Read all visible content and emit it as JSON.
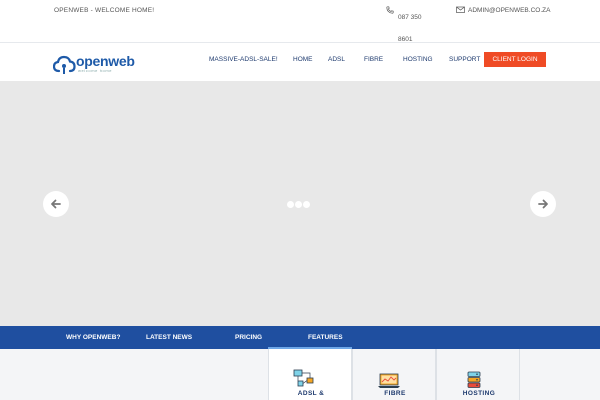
{
  "topbar": {
    "tagline": "OPENWEB - WELCOME HOME!",
    "phone": "087 350 8601",
    "email": "ADMIN@OPENWEB.CO.ZA"
  },
  "header": {
    "logo_text": "openweb",
    "logo_sub": "welcome home",
    "nav": [
      "MASSIVE-ADSL-SALE!",
      "HOME",
      "ADSL",
      "FIBRE",
      "HOSTING",
      "SUPPORT"
    ],
    "login_label": "CLIENT LOGIN"
  },
  "tabs": [
    "WHY OPENWEB?",
    "LATEST NEWS",
    "PRICING",
    "FEATURES"
  ],
  "active_tab": "FEATURES",
  "features": [
    {
      "label": "ADSL &",
      "icon": "network-icon"
    },
    {
      "label": "FIBRE",
      "icon": "laptop-chart-icon"
    },
    {
      "label": "HOSTING",
      "icon": "server-icon"
    }
  ],
  "colors": {
    "brand_blue": "#1f4fa0",
    "accent_orange": "#ef4b25",
    "slider_bg": "#e8e8e8"
  }
}
